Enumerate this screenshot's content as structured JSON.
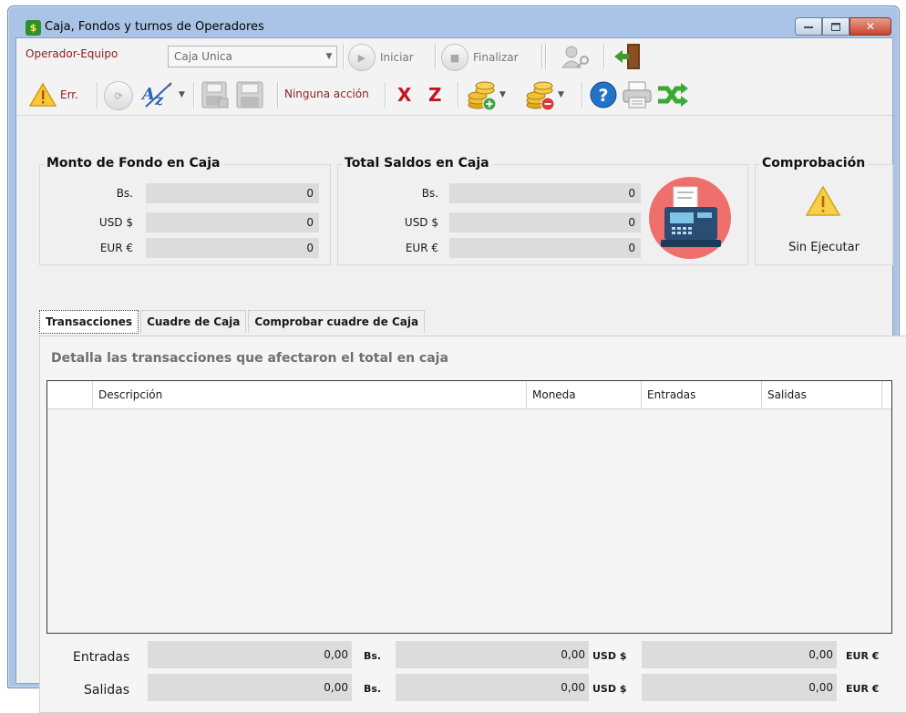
{
  "window": {
    "title": "Caja, Fondos y turnos de Operadores",
    "minimize_icon": "minimize-icon",
    "maximize_icon": "maximize-icon",
    "close_icon": "close-icon"
  },
  "toolbar1": {
    "operator_label": "Operador-Equipo",
    "combo_value": "Caja Unica",
    "start_label": "Iniciar",
    "finish_label": "Finalizar"
  },
  "toolbar2": {
    "error_label": "Err.",
    "action_status": "Ninguna acción",
    "x_label": "X",
    "z_label": "Z"
  },
  "fondo": {
    "title": "Monto de Fondo en Caja",
    "rows": [
      {
        "currency": "Bs.",
        "value": "0"
      },
      {
        "currency": "USD $",
        "value": "0"
      },
      {
        "currency": "EUR €",
        "value": "0"
      }
    ]
  },
  "saldos": {
    "title": "Total Saldos en Caja",
    "rows": [
      {
        "currency": "Bs.",
        "value": "0"
      },
      {
        "currency": "USD $",
        "value": "0"
      },
      {
        "currency": "EUR €",
        "value": "0"
      }
    ]
  },
  "comprobacion": {
    "title": "Comprobación",
    "status": "Sin Ejecutar"
  },
  "tabs": [
    {
      "label": "Transacciones",
      "active": true
    },
    {
      "label": "Cuadre de Caja",
      "active": false
    },
    {
      "label": "Comprobar cuadre de Caja",
      "active": false
    }
  ],
  "panel": {
    "title": "Detalla las transacciones que afectaron el total en caja",
    "columns": [
      "Descripción",
      "Moneda",
      "Entradas",
      "Salidas"
    ]
  },
  "totals": {
    "entradas_label": "Entradas",
    "salidas_label": "Salidas",
    "entradas": [
      {
        "value": "0,00",
        "currency": "Bs."
      },
      {
        "value": "0,00",
        "currency": "USD $"
      },
      {
        "value": "0,00",
        "currency": "EUR €"
      }
    ],
    "salidas": [
      {
        "value": "0,00",
        "currency": "Bs."
      },
      {
        "value": "0,00",
        "currency": "USD $"
      },
      {
        "value": "0,00",
        "currency": "EUR €"
      }
    ]
  },
  "colors": {
    "title_bg": "#a9c4e6",
    "accent_red": "#c0161f",
    "label_red": "#8a1f1f"
  }
}
